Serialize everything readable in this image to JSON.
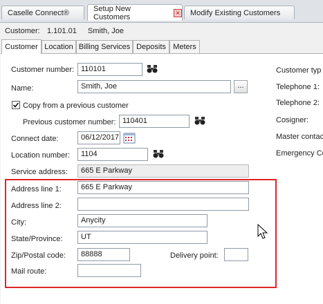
{
  "doc_tabs": [
    {
      "label": "Caselle Connect®"
    },
    {
      "label": "Setup New Customers"
    },
    {
      "label": "Modify Existing Customers"
    }
  ],
  "header": {
    "customer_label": "Customer:",
    "customer_id": "1.101.01",
    "customer_name": "Smith, Joe"
  },
  "tabs": [
    {
      "label": "Customer"
    },
    {
      "label": "Location"
    },
    {
      "label": "Billing Services"
    },
    {
      "label": "Deposits"
    },
    {
      "label": "Meters"
    }
  ],
  "form": {
    "customer_number_label": "Customer number:",
    "customer_number": "110101",
    "name_label": "Name:",
    "name": "Smith, Joe",
    "name_btn": "...",
    "copy_label": "Copy from a previous customer",
    "copy_checked": true,
    "prev_customer_label": "Previous customer number:",
    "prev_customer": "110401",
    "connect_date_label": "Connect date:",
    "connect_date": "06/12/2017",
    "location_number_label": "Location number:",
    "location_number": "1104",
    "service_address_label": "Service address:",
    "service_address": "665 E Parkway",
    "address1_label": "Address line 1:",
    "address1": "665 E Parkway",
    "address2_label": "Address line 2:",
    "address2": "",
    "city_label": "City:",
    "city": "Anycity",
    "state_label": "State/Province:",
    "state": "UT",
    "zip_label": "Zip/Postal code:",
    "zip": "88888",
    "delivery_label": "Delivery point:",
    "delivery": "",
    "mail_route_label": "Mail route:",
    "mail_route": ""
  },
  "right_labels": {
    "customer_type": "Customer typ",
    "telephone1": "Telephone 1:",
    "telephone2": "Telephone 2:",
    "cosigner": "Cosigner:",
    "master_contact": "Master contac",
    "emergency": "Emergency Co"
  },
  "icons": {
    "binoculars": "binoculars-icon",
    "calendar": "calendar-icon",
    "close": "close-icon",
    "cursor": "mouse-cursor-icon"
  },
  "colors": {
    "highlight_box": "#e02424",
    "close_tab": "#c04040"
  }
}
